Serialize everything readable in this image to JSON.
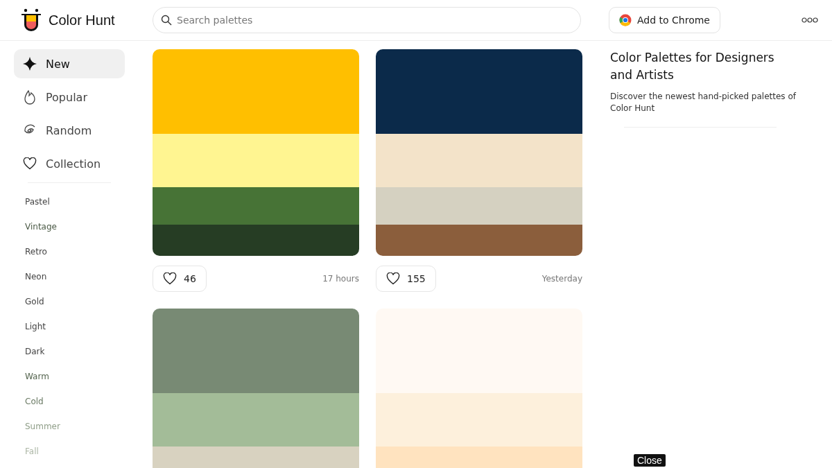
{
  "header": {
    "logo_text": "Color Hunt",
    "search": {
      "placeholder": "Search palettes"
    },
    "chrome_button": "Add to Chrome"
  },
  "nav": [
    {
      "label": "New",
      "kind": "sparkle",
      "selected": true
    },
    {
      "label": "Popular",
      "kind": "flame",
      "selected": false
    },
    {
      "label": "Random",
      "kind": "spiral",
      "selected": false
    },
    {
      "label": "Collection",
      "kind": "heart",
      "selected": false
    }
  ],
  "tags": [
    "Pastel",
    "Vintage",
    "Retro",
    "Neon",
    "Gold",
    "Light",
    "Dark",
    "Warm",
    "Cold",
    "Summer",
    "Fall"
  ],
  "palettes": [
    {
      "swatches": [
        {
          "color": "#ffbf00"
        },
        {
          "color": "#fff591"
        },
        {
          "color": "#477336"
        },
        {
          "color": "#263d24"
        }
      ],
      "likes": "46",
      "time": "17 hours"
    },
    {
      "swatches": [
        {
          "color": "#0b2a4a"
        },
        {
          "color": "#f3e3c9"
        },
        {
          "color": "#d5d1c1"
        },
        {
          "color": "#8b5e3c"
        }
      ],
      "likes": "155",
      "time": "Yesterday"
    },
    {
      "swatches": [
        {
          "color": "#788a74"
        },
        {
          "color": "#a3bc98"
        },
        {
          "color": "#d8d2c0"
        }
      ]
    },
    {
      "swatches": [
        {
          "color": "#fff9f3"
        },
        {
          "color": "#fdf0dc"
        },
        {
          "color": "#ffe3bf"
        }
      ]
    }
  ],
  "aside": {
    "title": "Color Palettes for Designers and Artists",
    "text": "Discover the newest hand-picked palettes of Color Hunt"
  },
  "close_button": "Close"
}
